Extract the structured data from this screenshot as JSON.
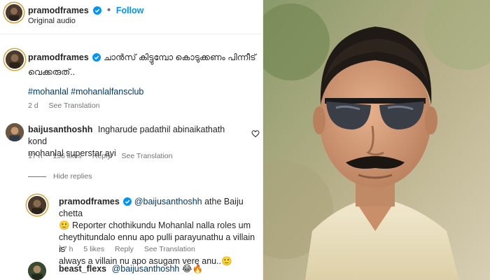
{
  "post": {
    "username": "pramodframes",
    "follow_label": "Follow",
    "audio_label": "Original audio"
  },
  "caption": {
    "username": "pramodframes",
    "text_line1": "ചാൻസ് കിട്ടുമ്പോ കൊടുക്കണം പിന്നീട്",
    "text_line2": "വെക്കരുത്..",
    "hashtags": "#mohanlal #mohanlalfansclub",
    "time": "2 d",
    "see_translation": "See Translation"
  },
  "comments": [
    {
      "username": "baijusanthoshh",
      "line1": "Ingharude padathil abinaikathath kond",
      "line2": "mohanlal superstar ayi",
      "time": "17 h",
      "likes": "156 likes",
      "reply": "Reply",
      "see_translation": "See Translation"
    }
  ],
  "hide_replies": "Hide replies",
  "reply": {
    "username": "pramodframes",
    "mention": "@baijusanthoshh",
    "line1_rest": " athe Baiju chetta",
    "line2": "🙂 Reporter chothikundu Mohanlal nalla roles um",
    "line3": "cheythitundalo ennu apo pulli parayunathu a villain is",
    "line4": "always a villain nu apo asugam vere anu..🙂",
    "time": "17 h",
    "likes": "5 likes",
    "reply_label": "Reply",
    "see_translation": "See Translation"
  },
  "next_comment": {
    "username": "beast_flexs",
    "mention": "@baijusanthoshh",
    "emojis": "😂🔥"
  },
  "colors": {
    "accent_blue": "#0095f6",
    "link_blue": "#00376b",
    "muted": "#737373"
  },
  "icons": [
    "verified-badge-icon",
    "heart-icon",
    "avatar-photo"
  ]
}
